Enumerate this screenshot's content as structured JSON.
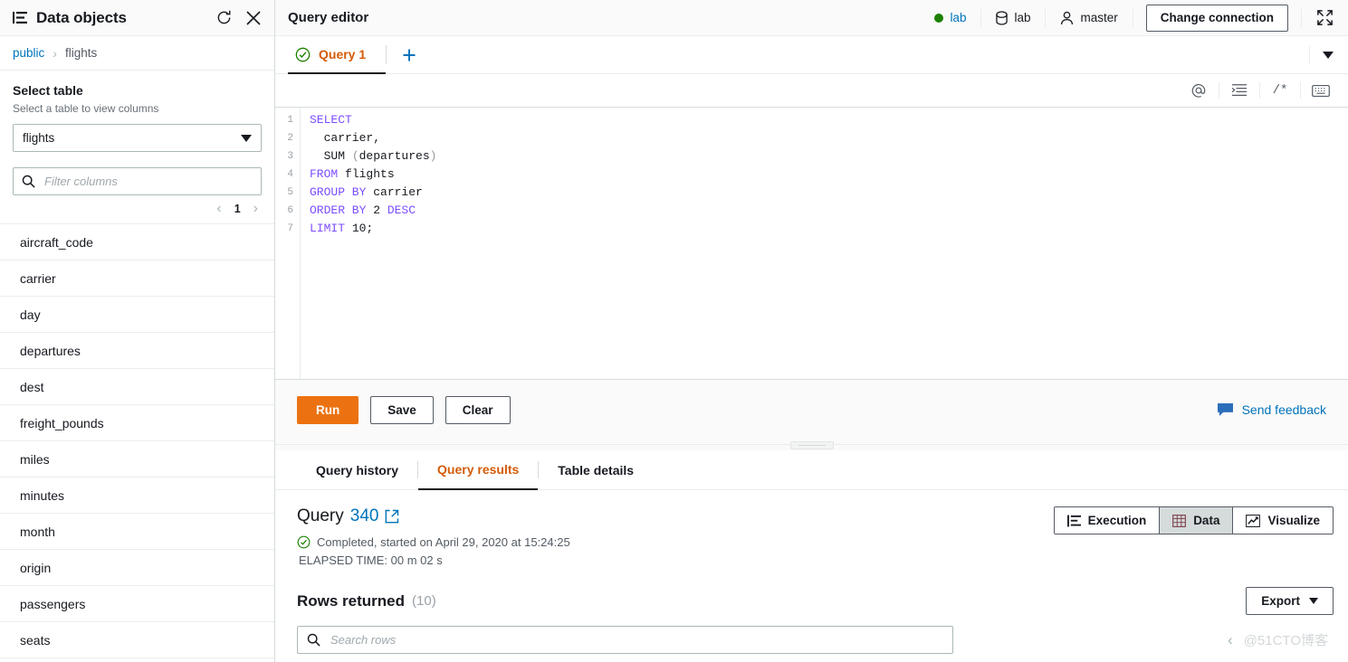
{
  "sidebar": {
    "title": "Data objects",
    "title_icon": "tree-list-icon",
    "refresh_icon": "refresh-icon",
    "close_icon": "close-icon",
    "breadcrumb": {
      "root": "public",
      "separator": "›",
      "current": "flights"
    },
    "select_table_label": "Select table",
    "select_table_description": "Select a table to view columns",
    "selected_table": "flights",
    "filter_placeholder": "Filter columns",
    "filter_value": "",
    "filter_icon": "search-icon",
    "pagination": {
      "prev": "‹",
      "page": "1",
      "next": "›"
    },
    "columns": [
      "aircraft_code",
      "carrier",
      "day",
      "departures",
      "dest",
      "freight_pounds",
      "miles",
      "minutes",
      "month",
      "origin",
      "passengers",
      "seats"
    ]
  },
  "topbar": {
    "title": "Query editor",
    "cluster_status": "lab",
    "database": "lab",
    "user": "master",
    "change_connection_label": "Change connection",
    "status_dot_color": "#1d8102",
    "db_icon": "database-icon",
    "user_icon": "user-icon",
    "expand_icon": "expand-icon"
  },
  "query_tabs": {
    "tabs": [
      {
        "label": "Query 1",
        "status_icon": "check-circle-icon",
        "active": true
      }
    ],
    "add_label": "+",
    "add_icon": "plus-icon",
    "overflow_icon": "chevron-down-icon"
  },
  "editor_toolbar": {
    "icons": [
      {
        "name": "at-icon",
        "glyph": "@"
      },
      {
        "name": "indent-icon",
        "glyph": "≡"
      },
      {
        "name": "comment-icon",
        "glyph": "/*"
      },
      {
        "name": "keyboard-icon",
        "glyph": "⌨"
      }
    ]
  },
  "editor": {
    "line_numbers": [
      "1",
      "2",
      "3",
      "4",
      "5",
      "6",
      "7"
    ],
    "lines": [
      {
        "text": "SELECT",
        "tokens": [
          {
            "t": "SELECT",
            "k": "kw"
          }
        ]
      },
      {
        "text": "  carrier,",
        "tokens": [
          {
            "t": "  carrier,",
            "k": ""
          }
        ]
      },
      {
        "text": "  SUM (departures)",
        "tokens": [
          {
            "t": "  SUM ",
            "k": ""
          },
          {
            "t": "(",
            "k": "punct"
          },
          {
            "t": "departures",
            "k": ""
          },
          {
            "t": ")",
            "k": "punct"
          }
        ]
      },
      {
        "text": "FROM flights",
        "tokens": [
          {
            "t": "FROM",
            "k": "kw"
          },
          {
            "t": " flights",
            "k": ""
          }
        ]
      },
      {
        "text": "GROUP BY carrier",
        "tokens": [
          {
            "t": "GROUP BY",
            "k": "kw"
          },
          {
            "t": " carrier",
            "k": ""
          }
        ]
      },
      {
        "text": "ORDER BY 2 DESC",
        "tokens": [
          {
            "t": "ORDER BY",
            "k": "kw"
          },
          {
            "t": " 2 ",
            "k": ""
          },
          {
            "t": "DESC",
            "k": "kw"
          }
        ]
      },
      {
        "text": "LIMIT 10;",
        "tokens": [
          {
            "t": "LIMIT",
            "k": "kw"
          },
          {
            "t": " 10;",
            "k": ""
          }
        ]
      }
    ]
  },
  "actions": {
    "run_label": "Run",
    "save_label": "Save",
    "clear_label": "Clear",
    "feedback_label": "Send feedback",
    "feedback_icon": "speech-bubble-icon",
    "run_color": "#ec7211"
  },
  "result_tabs": [
    {
      "label": "Query history",
      "active": false
    },
    {
      "label": "Query results",
      "active": true
    },
    {
      "label": "Table details",
      "active": false
    }
  ],
  "results": {
    "query_word": "Query",
    "query_id": "340",
    "external_link_icon": "external-link-icon",
    "status_icon": "check-circle-icon",
    "status_text": "Completed, started on April 29, 2020 at 15:24:25",
    "elapsed_text": "ELAPSED TIME: 00 m 02 s",
    "view_modes": [
      {
        "label": "Execution",
        "icon": "execution-icon",
        "active": false
      },
      {
        "label": "Data",
        "icon": "grid-icon",
        "active": true
      },
      {
        "label": "Visualize",
        "icon": "chart-line-icon",
        "active": false
      }
    ],
    "rows_returned_label": "Rows returned",
    "rows_returned_count": "(10)",
    "export_label": "Export",
    "search_placeholder": "Search rows",
    "search_value": "",
    "search_icon": "search-icon",
    "prev_page_icon": "chevron-left-icon",
    "watermark": "@51CTO博客"
  }
}
